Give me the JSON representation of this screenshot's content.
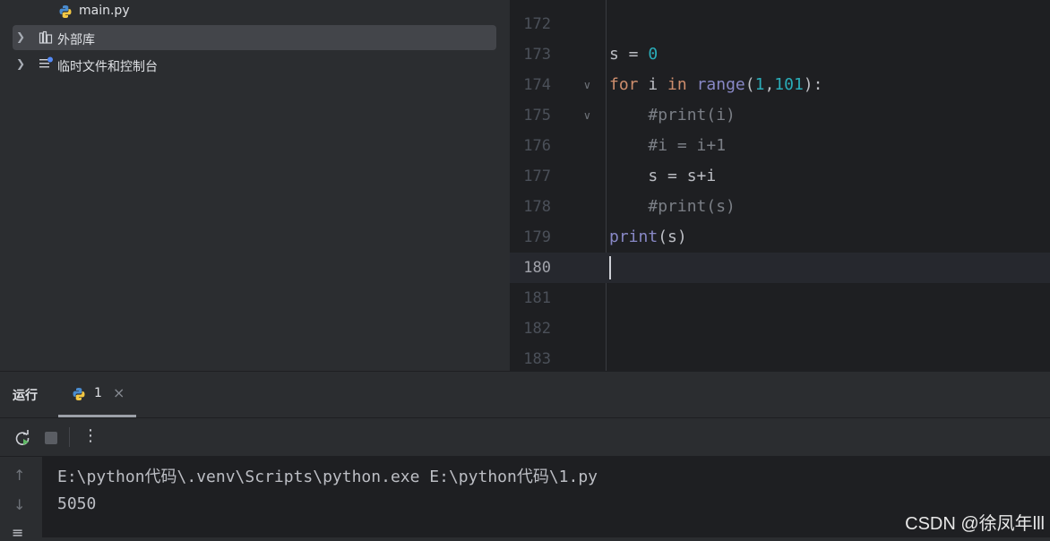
{
  "project_tree": {
    "items": [
      {
        "label": "main.py",
        "icon": "python-file-icon"
      },
      {
        "label": "外部库",
        "icon": "library-icon"
      },
      {
        "label": "临时文件和控制台",
        "icon": "scratches-icon"
      }
    ]
  },
  "editor": {
    "lines": [
      {
        "num": "172"
      },
      {
        "num": "173",
        "code": [
          {
            "t": "s = "
          },
          {
            "t": "0",
            "c": "num"
          }
        ]
      },
      {
        "num": "174",
        "fold": "∨",
        "code": [
          {
            "t": "for",
            "c": "kw"
          },
          {
            "t": " i "
          },
          {
            "t": "in",
            "c": "kw"
          },
          {
            "t": " "
          },
          {
            "t": "range",
            "c": "bi"
          },
          {
            "t": "("
          },
          {
            "t": "1",
            "c": "num"
          },
          {
            "t": ","
          },
          {
            "t": "101",
            "c": "num"
          },
          {
            "t": "):"
          }
        ]
      },
      {
        "num": "175",
        "fold": "∨",
        "code": [
          {
            "t": "    "
          },
          {
            "t": "#print(i)",
            "c": "cm"
          }
        ]
      },
      {
        "num": "176",
        "code": [
          {
            "t": "    "
          },
          {
            "t": "#i = i+1",
            "c": "cm"
          }
        ]
      },
      {
        "num": "177",
        "code": [
          {
            "t": "    s = s+i"
          }
        ]
      },
      {
        "num": "178",
        "code": [
          {
            "t": "    "
          },
          {
            "t": "#print(s)",
            "c": "cm"
          }
        ]
      },
      {
        "num": "179",
        "code": [
          {
            "t": "print",
            "c": "bi"
          },
          {
            "t": "(s)"
          }
        ]
      },
      {
        "num": "180",
        "current": true
      },
      {
        "num": "181"
      },
      {
        "num": "182"
      },
      {
        "num": "183"
      }
    ]
  },
  "run_panel": {
    "title": "运行",
    "tab_label": "1",
    "tab_close": "×",
    "output": [
      "E:\\python代码\\.venv\\Scripts\\python.exe E:\\python代码\\1.py",
      "5050"
    ]
  },
  "watermark": "CSDN @徐凤年lll",
  "colors": {
    "background": "#2b2d30",
    "editor_bg": "#1e1f22",
    "keyword": "#cf8e6d",
    "number": "#2aacb8",
    "builtin": "#8888c6",
    "comment": "#7a7e85"
  }
}
